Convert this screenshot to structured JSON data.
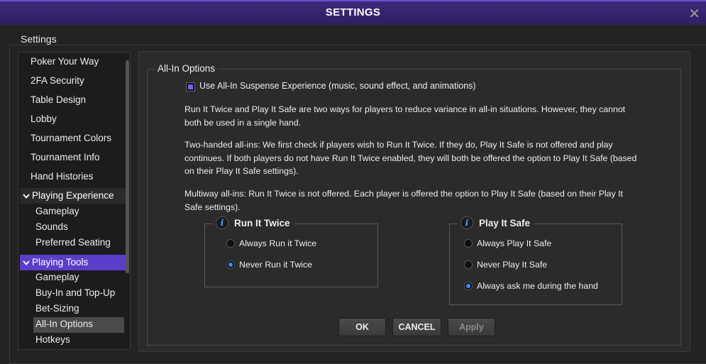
{
  "window": {
    "title": "SETTINGS",
    "close_glyph": "✕"
  },
  "outer_label": "Settings",
  "sidebar": {
    "top_items": [
      "Poker Your Way",
      "2FA Security",
      "Table Design",
      "Lobby",
      "Tournament Colors",
      "Tournament Info",
      "Hand Histories"
    ],
    "playing_experience": {
      "label": "Playing Experience",
      "items": [
        "Gameplay",
        "Sounds",
        "Preferred Seating"
      ]
    },
    "playing_tools": {
      "label": "Playing Tools",
      "items": [
        "Gameplay",
        "Buy-In and Top-Up",
        "Bet-Sizing",
        "All-In Options",
        "Hotkeys"
      ],
      "selected": "All-In Options"
    }
  },
  "panel": {
    "group_label": "All-In Options",
    "suspense_checkbox": {
      "label": "Use All-In Suspense Experience (music, sound effect, and animations)",
      "checked": true
    },
    "paragraphs": [
      "Run It Twice and Play It Safe are two ways for players to reduce variance in all-in situations. However, they cannot both be used in a single hand.",
      "Two-handed all-ins: We first check if players wish to Run It Twice. If they do, Play It Safe is not offered and play continues. If both players do not have Run It Twice enabled, they will both be offered the option to Play It Safe (based on their Play It Safe settings).",
      "Multiway all-ins: Run It Twice is not offered. Each player is offered the option to Play It Safe (based on their Play It Safe settings)."
    ],
    "run_it_twice": {
      "title": "Run It Twice",
      "options": [
        "Always Run it Twice",
        "Never Run it Twice"
      ],
      "selected": "Never Run it Twice"
    },
    "play_it_safe": {
      "title": "Play It Safe",
      "options": [
        "Always Play It Safe",
        "Never Play It Safe",
        "Always ask me during the hand"
      ],
      "selected": "Always ask me during the hand"
    }
  },
  "buttons": {
    "ok": "OK",
    "cancel": "CANCEL",
    "apply": "Apply"
  },
  "colors": {
    "accent": "#5a3ec8",
    "title_bar": "#2e1f63",
    "radio_on": "#3d8bff"
  }
}
